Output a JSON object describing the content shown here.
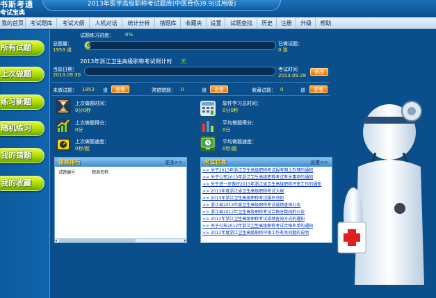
{
  "header": {
    "logo_main": "书斯考通",
    "logo_sub": "考试宝典",
    "title": "2013年医学高级职称考试题库(中医骨伤)9.9[试用版]"
  },
  "menu": [
    {
      "label": "我的首页"
    },
    {
      "label": "考试题库"
    },
    {
      "label": "考试大纲"
    },
    {
      "label": "人机对话"
    },
    {
      "label": "统计分析"
    },
    {
      "label": "错题库"
    },
    {
      "label": "收藏夹"
    },
    {
      "label": "设置"
    },
    {
      "label": "试题查找"
    },
    {
      "label": "历史"
    },
    {
      "label": "注册"
    },
    {
      "label": "升级"
    },
    {
      "label": "帮助"
    }
  ],
  "sidebar": [
    {
      "label": "所有试题"
    },
    {
      "label": "上次做题"
    },
    {
      "label": "练习新题"
    },
    {
      "label": "随机练习"
    },
    {
      "label": "我的错题"
    },
    {
      "label": "我的收藏"
    }
  ],
  "progress": {
    "label": "试题练习进度：",
    "value_text": "0%",
    "fraction": 0.0,
    "bar_pct": "0%",
    "total_label": "总题量：",
    "total_value": "1953 道",
    "done_label": "已做试题：",
    "done_value": "0 道"
  },
  "countdown": {
    "label": "2013年浙江卫生高级职称考试倒计时",
    "unit": "天",
    "current_date_label": "当前日期：",
    "current_date": "2013.09.30",
    "exam_time_label": "考试时间",
    "exam_time": "2013.09.28",
    "modify_button": "修改",
    "fraction": 0.0
  },
  "counts": {
    "undone_label": "未做试题：",
    "undone_value": "1953",
    "unit": "道",
    "view_button": "查看",
    "wrong_label": "答错错题：",
    "wrong_value": "0",
    "fav_label": "收藏试题：",
    "fav_value": "0"
  },
  "stats": {
    "last_time_label": "上次做题时间：",
    "last_time_value": "0分0秒",
    "software_time_label": "软件学习总时间：",
    "software_time_value": "0分0秒",
    "last_score_label": "上次做题得分：",
    "last_score_value": "0分",
    "avg_score_label": "平均做题得分：",
    "avg_score_value": "0分",
    "last_speed_label": "上次做题速度：",
    "last_speed_value": "0秒/题",
    "avg_speed_label": "平均做题速度：",
    "avg_speed_value": "0秒/题"
  },
  "wrong_rank": {
    "title": "错题排行",
    "more": "更多>>",
    "col_num": "试题编号",
    "col_name": "题目名称"
  },
  "exam_info": {
    "title": "考试信息",
    "more": "设置>>",
    "items": [
      {
        "text": ">> 关于2013年浙江卫生高级职称考试报考网上办理的通知"
      },
      {
        "text": ">> 关于公布2013年浙江卫生高级职称考试有关事项的通知"
      },
      {
        "text": ">> 关于进一步做好2013年浙江省卫生高级职称评审工作的通知"
      },
      {
        "text": ">> 2013年度浙江省卫生高级职称考试大纲"
      },
      {
        "text": ">> 2013年浙江卫生高级职称考试报名须知"
      },
      {
        "text": ">> 浙江省2013年度卫生高级职称考试成绩查询公告"
      },
      {
        "text": ">> 浙江省2012年卫生高级职称考试合格分数线的公告"
      },
      {
        "text": ">> 2012年浙江卫生高级职称考试成绩查询方式的通知"
      },
      {
        "text": ">> 关于公布2012年浙江卫生高级职称考试合格名单的通知"
      },
      {
        "text": ">> 2012年度浙江卫生高级职称评审工作有关问题的说明"
      }
    ]
  },
  "colors": {
    "background": "#0a4f8c",
    "accent_green": "#a3d500",
    "accent_orange": "#e66d00",
    "label_yellow": "#ffee44"
  }
}
